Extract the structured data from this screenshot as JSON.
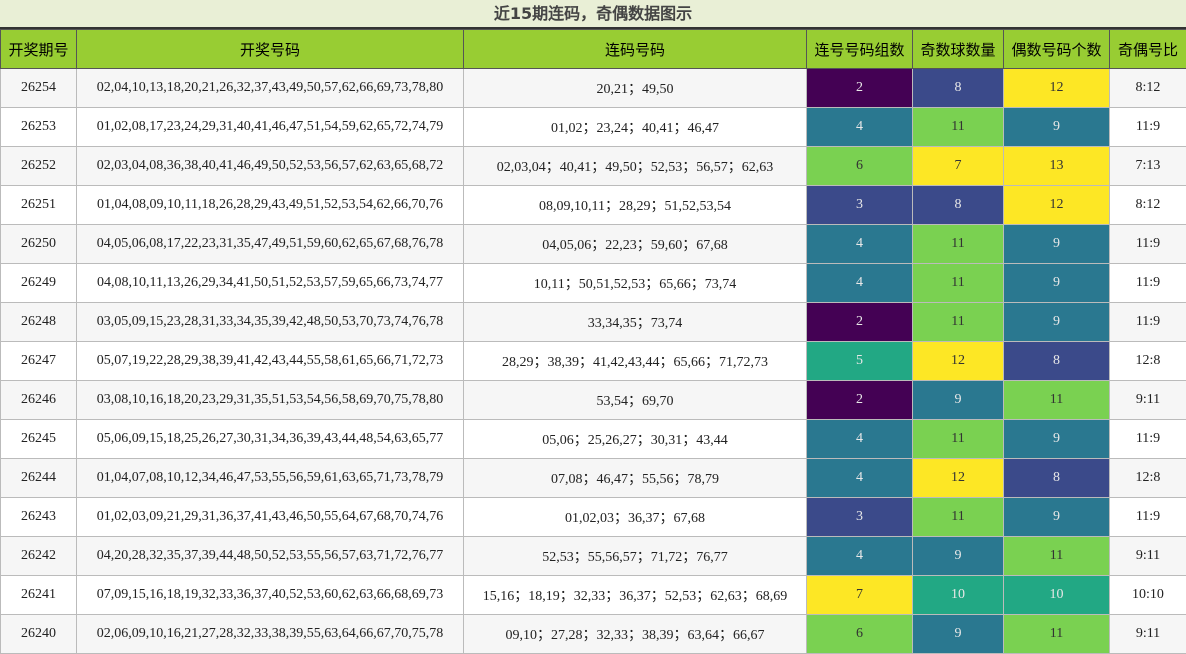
{
  "title": "近15期连码，奇偶数据图示",
  "headers": [
    "开奖期号",
    "开奖号码",
    "连码号码",
    "连号号码组数",
    "奇数球数量",
    "偶数号码个数",
    "奇偶号比"
  ],
  "palette": {
    "2": "#440154",
    "3": "#3b4a8a",
    "4": "#2a7890",
    "5": "#22a884",
    "6": "#7ad151",
    "7": "#fde725",
    "8": "#3b4a8a",
    "9": "#2a7890",
    "10": "#22a884",
    "11": "#7ad151",
    "12": "#fde725",
    "13": "#fde725"
  },
  "rows": [
    {
      "period": "26254",
      "numbers": "02,04,10,13,18,20,21,26,32,37,43,49,50,57,62,66,69,73,78,80",
      "consecutive": "20,21；49,50",
      "groups": 2,
      "odd": 8,
      "even": 12,
      "ratio": "8:12"
    },
    {
      "period": "26253",
      "numbers": "01,02,08,17,23,24,29,31,40,41,46,47,51,54,59,62,65,72,74,79",
      "consecutive": "01,02；23,24；40,41；46,47",
      "groups": 4,
      "odd": 11,
      "even": 9,
      "ratio": "11:9"
    },
    {
      "period": "26252",
      "numbers": "02,03,04,08,36,38,40,41,46,49,50,52,53,56,57,62,63,65,68,72",
      "consecutive": "02,03,04；40,41；49,50；52,53；56,57；62,63",
      "groups": 6,
      "odd": 7,
      "even": 13,
      "ratio": "7:13"
    },
    {
      "period": "26251",
      "numbers": "01,04,08,09,10,11,18,26,28,29,43,49,51,52,53,54,62,66,70,76",
      "consecutive": "08,09,10,11；28,29；51,52,53,54",
      "groups": 3,
      "odd": 8,
      "even": 12,
      "ratio": "8:12"
    },
    {
      "period": "26250",
      "numbers": "04,05,06,08,17,22,23,31,35,47,49,51,59,60,62,65,67,68,76,78",
      "consecutive": "04,05,06；22,23；59,60；67,68",
      "groups": 4,
      "odd": 11,
      "even": 9,
      "ratio": "11:9"
    },
    {
      "period": "26249",
      "numbers": "04,08,10,11,13,26,29,34,41,50,51,52,53,57,59,65,66,73,74,77",
      "consecutive": "10,11；50,51,52,53；65,66；73,74",
      "groups": 4,
      "odd": 11,
      "even": 9,
      "ratio": "11:9"
    },
    {
      "period": "26248",
      "numbers": "03,05,09,15,23,28,31,33,34,35,39,42,48,50,53,70,73,74,76,78",
      "consecutive": "33,34,35；73,74",
      "groups": 2,
      "odd": 11,
      "even": 9,
      "ratio": "11:9"
    },
    {
      "period": "26247",
      "numbers": "05,07,19,22,28,29,38,39,41,42,43,44,55,58,61,65,66,71,72,73",
      "consecutive": "28,29；38,39；41,42,43,44；65,66；71,72,73",
      "groups": 5,
      "odd": 12,
      "even": 8,
      "ratio": "12:8"
    },
    {
      "period": "26246",
      "numbers": "03,08,10,16,18,20,23,29,31,35,51,53,54,56,58,69,70,75,78,80",
      "consecutive": "53,54；69,70",
      "groups": 2,
      "odd": 9,
      "even": 11,
      "ratio": "9:11"
    },
    {
      "period": "26245",
      "numbers": "05,06,09,15,18,25,26,27,30,31,34,36,39,43,44,48,54,63,65,77",
      "consecutive": "05,06；25,26,27；30,31；43,44",
      "groups": 4,
      "odd": 11,
      "even": 9,
      "ratio": "11:9"
    },
    {
      "period": "26244",
      "numbers": "01,04,07,08,10,12,34,46,47,53,55,56,59,61,63,65,71,73,78,79",
      "consecutive": "07,08；46,47；55,56；78,79",
      "groups": 4,
      "odd": 12,
      "even": 8,
      "ratio": "12:8"
    },
    {
      "period": "26243",
      "numbers": "01,02,03,09,21,29,31,36,37,41,43,46,50,55,64,67,68,70,74,76",
      "consecutive": "01,02,03；36,37；67,68",
      "groups": 3,
      "odd": 11,
      "even": 9,
      "ratio": "11:9"
    },
    {
      "period": "26242",
      "numbers": "04,20,28,32,35,37,39,44,48,50,52,53,55,56,57,63,71,72,76,77",
      "consecutive": "52,53；55,56,57；71,72；76,77",
      "groups": 4,
      "odd": 9,
      "even": 11,
      "ratio": "9:11"
    },
    {
      "period": "26241",
      "numbers": "07,09,15,16,18,19,32,33,36,37,40,52,53,60,62,63,66,68,69,73",
      "consecutive": "15,16；18,19；32,33；36,37；52,53；62,63；68,69",
      "groups": 7,
      "odd": 10,
      "even": 10,
      "ratio": "10:10"
    },
    {
      "period": "26240",
      "numbers": "02,06,09,10,16,21,27,28,32,33,38,39,55,63,64,66,67,70,75,78",
      "consecutive": "09,10；27,28；32,33；38,39；63,64；66,67",
      "groups": 6,
      "odd": 9,
      "even": 11,
      "ratio": "9:11"
    }
  ]
}
